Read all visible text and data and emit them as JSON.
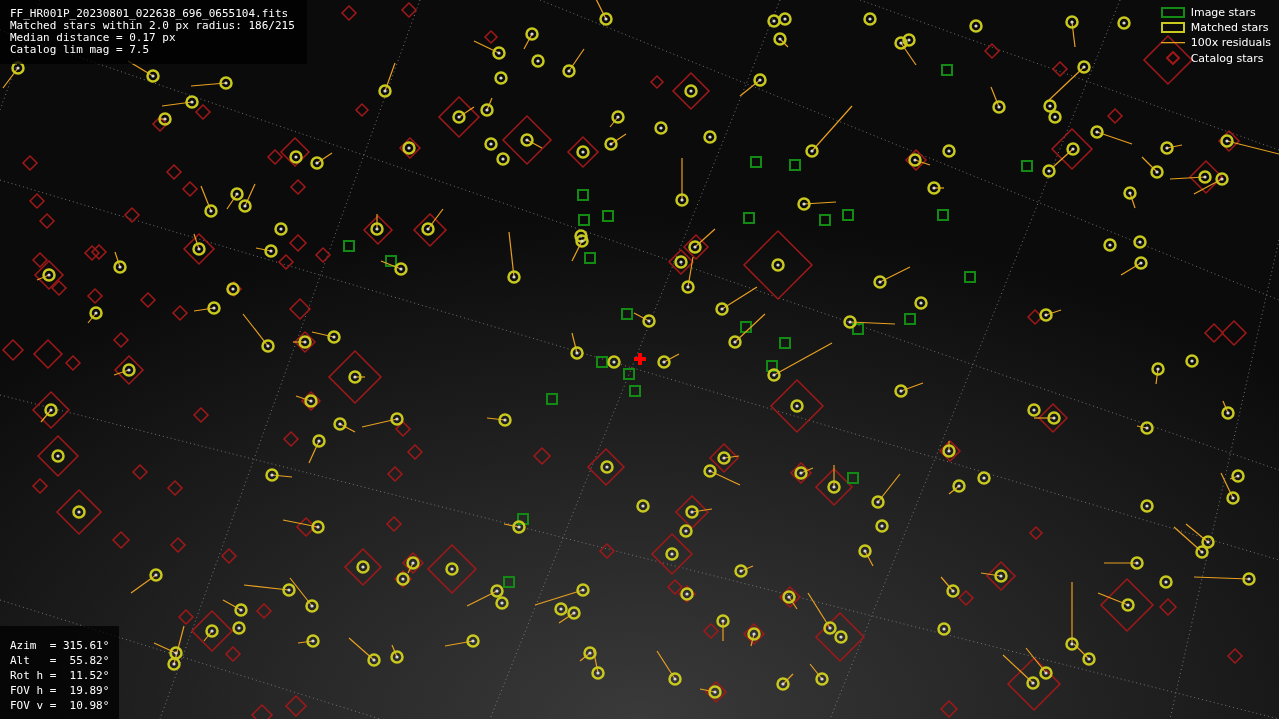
{
  "header": {
    "lines": [
      "FF_HR001P_20230801_022638_696_0655104.fits",
      "Matched stars within 2.0 px radius: 186/215",
      "Median distance = 0.17 px",
      "Catalog lim mag = 7.5"
    ]
  },
  "legend": [
    {
      "kind": "image",
      "label": "Image stars",
      "color": "#138a13"
    },
    {
      "kind": "matched",
      "label": "Matched stars",
      "color": "#c8c81e"
    },
    {
      "kind": "residual",
      "label": "100x residuals",
      "color": "#e8a020"
    },
    {
      "kind": "catalog",
      "label": "Catalog stars",
      "color": "#a01818"
    }
  ],
  "pointing": {
    "lines": [
      "Azim  = 315.61°",
      "Alt   =  55.82°",
      "Rot h =  11.52°",
      "FOV h =  19.89°",
      "FOV v =  10.98°"
    ]
  }
}
